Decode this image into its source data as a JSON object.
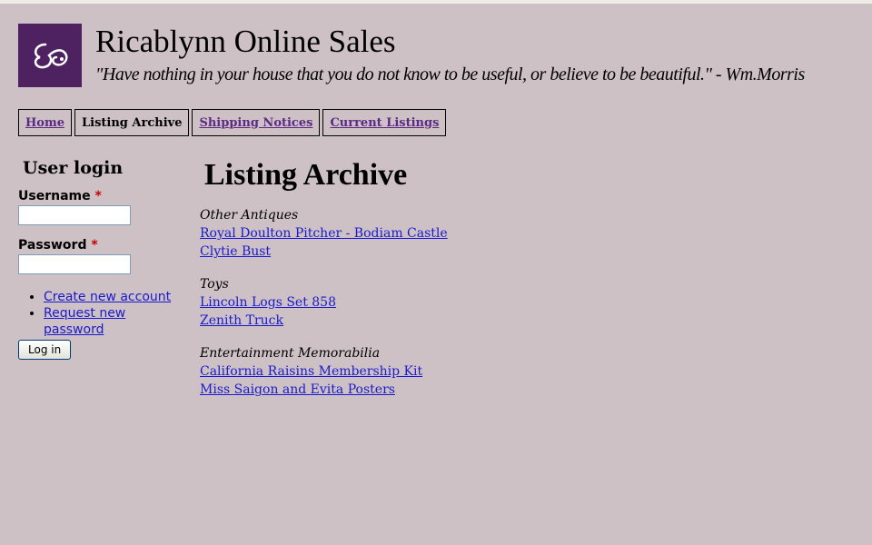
{
  "header": {
    "site_name": "Ricablynn Online Sales",
    "slogan": "\"Have nothing in your house that you do not know to be useful, or believe to be beautiful.\" - Wm.Morris",
    "logo_icon": "swirl-monogram-icon",
    "logo_color": "#4e2160"
  },
  "nav": {
    "items": [
      {
        "label": "Home",
        "active": false
      },
      {
        "label": "Listing Archive",
        "active": true
      },
      {
        "label": "Shipping Notices",
        "active": false
      },
      {
        "label": "Current Listings",
        "active": false
      }
    ]
  },
  "login": {
    "title": "User login",
    "username_label": "Username",
    "password_label": "Password",
    "required_marker": "*",
    "username_value": "",
    "password_value": "",
    "links": [
      "Create new account",
      "Request new password"
    ],
    "submit_label": "Log in"
  },
  "main": {
    "title": "Listing Archive",
    "categories": [
      {
        "name": "Other Antiques",
        "items": [
          "Royal Doulton Pitcher - Bodiam Castle",
          "Clytie Bust"
        ]
      },
      {
        "name": "Toys",
        "items": [
          "Lincoln Logs Set 858",
          "Zenith Truck"
        ]
      },
      {
        "name": "Entertainment Memorabilia",
        "items": [
          "California Raisins Membership Kit",
          "Miss Saigon and Evita Posters"
        ]
      }
    ]
  },
  "colors": {
    "background": "#cdc1c6",
    "link": "#1a1acc",
    "nav_link": "#5c2a82"
  }
}
